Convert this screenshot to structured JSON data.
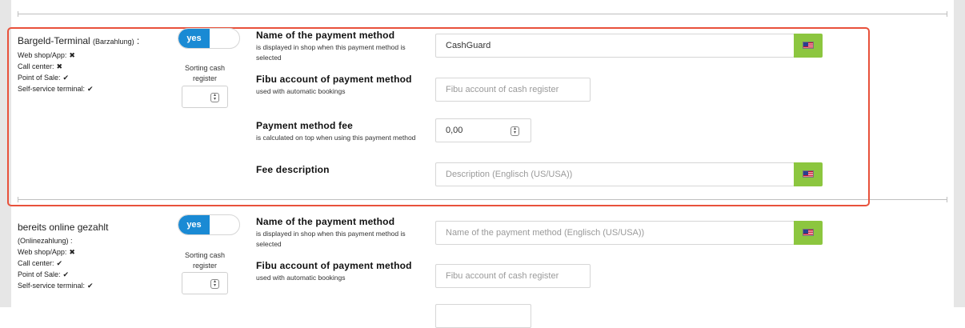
{
  "colors": {
    "accent_blue": "#1a8ad4",
    "flag_button_green": "#8cc63f",
    "highlight_red": "#e8513b"
  },
  "icons": {
    "language_flag": "us-flag-icon",
    "check": "checkmark-icon",
    "cross": "x-mark-icon"
  },
  "sections": [
    {
      "method_name": "Bargeld-Terminal",
      "method_type": "(Barzahlung)",
      "colon": ":",
      "availability": [
        {
          "label": "Web shop/App:",
          "symbol": "✖"
        },
        {
          "label": "Call center:",
          "symbol": "✖"
        },
        {
          "label": "Point of Sale:",
          "symbol": "✔"
        },
        {
          "label": "Self-service terminal:",
          "symbol": "✔"
        }
      ],
      "toggle_label": "yes",
      "sorting_label": "Sorting cash register",
      "fields": {
        "name_title": "Name of the payment method",
        "name_desc": "is displayed in shop when this payment method is selected",
        "name_value": "CashGuard",
        "name_placeholder": "",
        "fibu_title": "Fibu account of payment method",
        "fibu_desc": "used with automatic bookings",
        "fibu_placeholder": "Fibu account of cash register",
        "fee_title": "Payment method fee",
        "fee_desc": "is calculated on top when using this payment method",
        "fee_value": "0,00",
        "feedesc_title": "Fee description",
        "feedesc_placeholder": "Description (Englisch (US/USA))"
      }
    },
    {
      "method_name": "bereits online gezahlt",
      "method_type": "(Onlinezahlung) :",
      "availability": [
        {
          "label": "Web shop/App:",
          "symbol": "✖"
        },
        {
          "label": "Call center:",
          "symbol": "✔"
        },
        {
          "label": "Point of Sale:",
          "symbol": "✔"
        },
        {
          "label": "Self-service terminal:",
          "symbol": "✔"
        }
      ],
      "toggle_label": "yes",
      "sorting_label": "Sorting cash register",
      "fields": {
        "name_title": "Name of the payment method",
        "name_desc": "is displayed in shop when this payment method is selected",
        "name_placeholder": "Name of the payment method (Englisch (US/USA))",
        "fibu_title": "Fibu account of payment method",
        "fibu_desc": "used with automatic bookings",
        "fibu_placeholder": "Fibu account of cash register"
      }
    }
  ]
}
